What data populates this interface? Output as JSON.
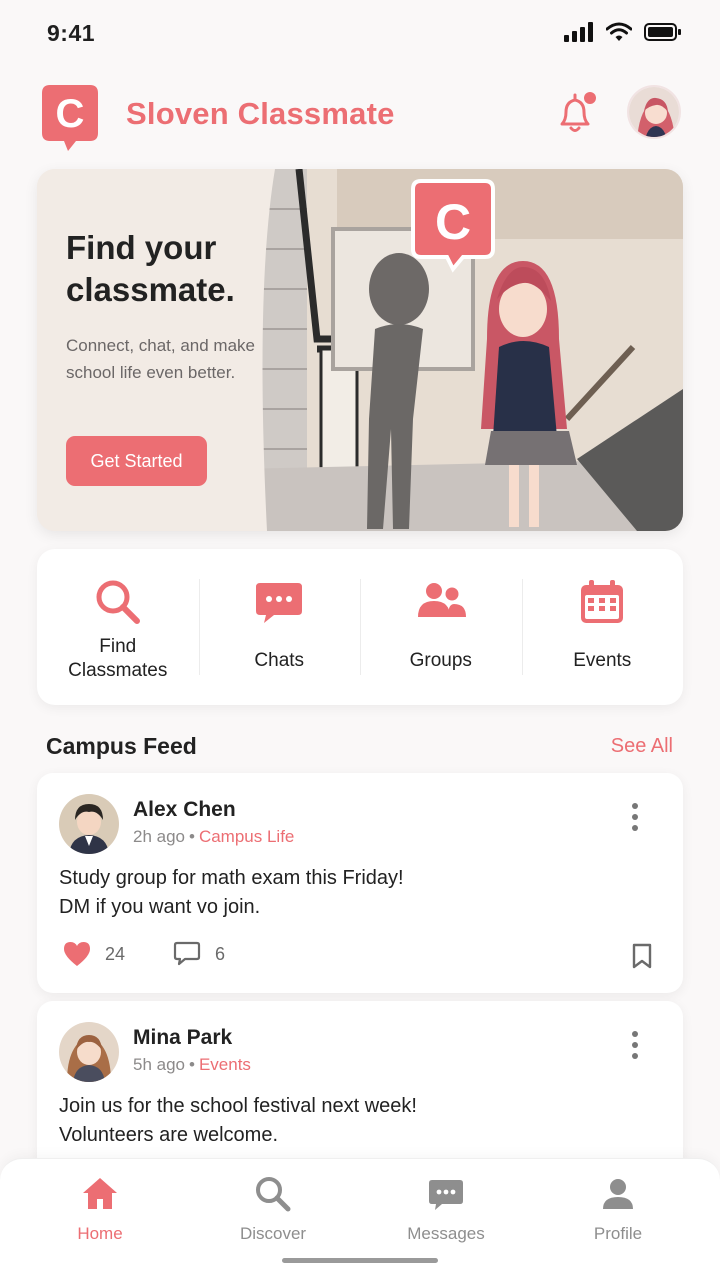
{
  "status": {
    "time": "9:41"
  },
  "header": {
    "title": "Sloven Classmate",
    "logo_letter": "C",
    "notification": true
  },
  "hero": {
    "title": "Find your classmate.",
    "subtitle": "Connect, chat, and make school life even better.",
    "button": "Get Started"
  },
  "quick_actions": [
    {
      "label": "Find Classmates",
      "icon": "search-icon"
    },
    {
      "label": "Chats",
      "icon": "chat-bubble-icon"
    },
    {
      "label": "Groups",
      "icon": "people-icon"
    },
    {
      "label": "Events",
      "icon": "calendar-icon"
    }
  ],
  "feed": {
    "title": "Campus Feed",
    "see_all": "See All",
    "posts": [
      {
        "author": "Alex Chen",
        "time": "2h ago",
        "category": "Campus Life",
        "body_line1": "Study group for math exam this Friday!",
        "body_line2": "DM if you want vo join.",
        "likes": "24",
        "comments": "6"
      },
      {
        "author": "Mina Park",
        "time": "5h ago",
        "category": "Events",
        "body_line1": "Join us for the school festival next week!",
        "body_line2": "Volunteers are welcome."
      }
    ]
  },
  "nav": [
    {
      "label": "Home",
      "active": true
    },
    {
      "label": "Discover"
    },
    {
      "label": "Messages"
    },
    {
      "label": "Profile"
    }
  ],
  "colors": {
    "accent": "#ec6e73",
    "background": "#faf8f8",
    "text": "#222222"
  }
}
